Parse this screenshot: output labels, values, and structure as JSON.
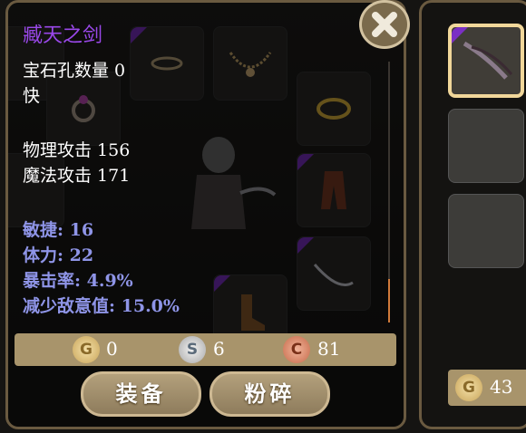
{
  "item": {
    "name": "臧天之剑",
    "gem_slots": "宝石孔数量 0",
    "speed": "快",
    "physical_attack": "物理攻击 156",
    "magic_attack": "魔法攻击 171",
    "stats": [
      "敏捷: 16",
      "体力: 22",
      "暴击率: 4.9%",
      "减少敌意值: 15.0%"
    ]
  },
  "currency": {
    "gold": "0",
    "silver": "6",
    "copper": "81",
    "gold_letter": "G",
    "silver_letter": "S",
    "copper_letter": "C"
  },
  "buttons": {
    "equip": "装备",
    "smash": "粉碎"
  },
  "side_panel": {
    "gold": "43",
    "gold_letter": "G"
  },
  "colors": {
    "item_name": "#9a48ea",
    "stat_text": "#8f95e8",
    "rarity_corner": "#7b2fc4",
    "panel_border": "#6a5a40",
    "selected_border": "#f1d79a"
  }
}
